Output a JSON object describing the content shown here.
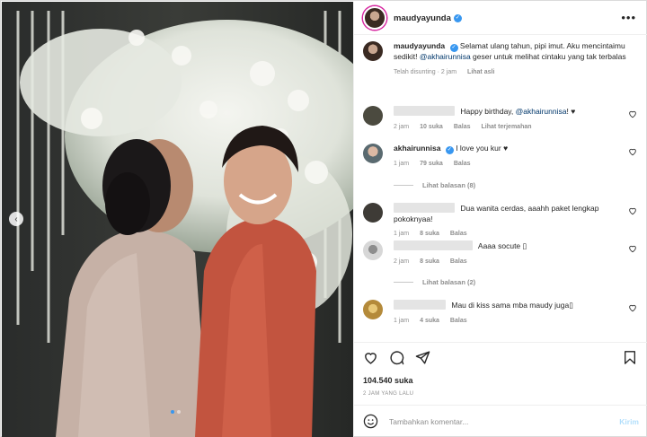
{
  "post": {
    "username": "maudyayunda",
    "verified": true,
    "caption_text": "Selamat ulang tahun, pipi imut. Aku mencintaimu sedikit!",
    "caption_mention": "@akhairunnisa",
    "caption_rest": "geser untuk melihat cintaku yang tak terbalas",
    "edited_label": "Telah disunting · 2 jam",
    "see_original": "Lihat asli",
    "likes": "104.540 suka",
    "time_ago": "2 JAM YANG LALU"
  },
  "comments": [
    {
      "time": "2 jam",
      "likes": "10 suka",
      "reply": "Balas",
      "translate": "Lihat terjemahan",
      "text_pre": "Happy birthday,",
      "mention": "@akhairunnisa",
      "text_post": "! ♥"
    },
    {
      "name": "akhairunnisa",
      "verified": true,
      "text": "I love you kur ♥",
      "time": "1 jam",
      "likes": "79 suka",
      "reply": "Balas",
      "view_replies": "Lihat balasan (8)"
    },
    {
      "text": "Dua wanita cerdas, aaahh paket lengkap pokoknyaa!",
      "time": "1 jam",
      "likes": "8 suka",
      "reply": "Balas"
    },
    {
      "text": "Aaaa socute ▯",
      "time": "2 jam",
      "likes": "8 suka",
      "reply": "Balas",
      "view_replies": "Lihat balasan (2)"
    },
    {
      "text": "Mau di kiss sama mba maudy juga▯",
      "time": "1 jam",
      "likes": "4 suka",
      "reply": "Balas"
    }
  ],
  "composer": {
    "placeholder": "Tambahkan komentar...",
    "submit": "Kirim"
  },
  "icons": {
    "header_more": "more-icon",
    "like": "heart-icon",
    "comment": "comment-icon",
    "share": "send-icon",
    "save": "bookmark-icon",
    "emoji": "emoji-icon",
    "prev": "chevron-left-icon"
  },
  "colors": {
    "verified": "#3897f0",
    "link": "#00376b",
    "muted": "#8e8e8e",
    "send_disabled": "#b2dffc"
  }
}
